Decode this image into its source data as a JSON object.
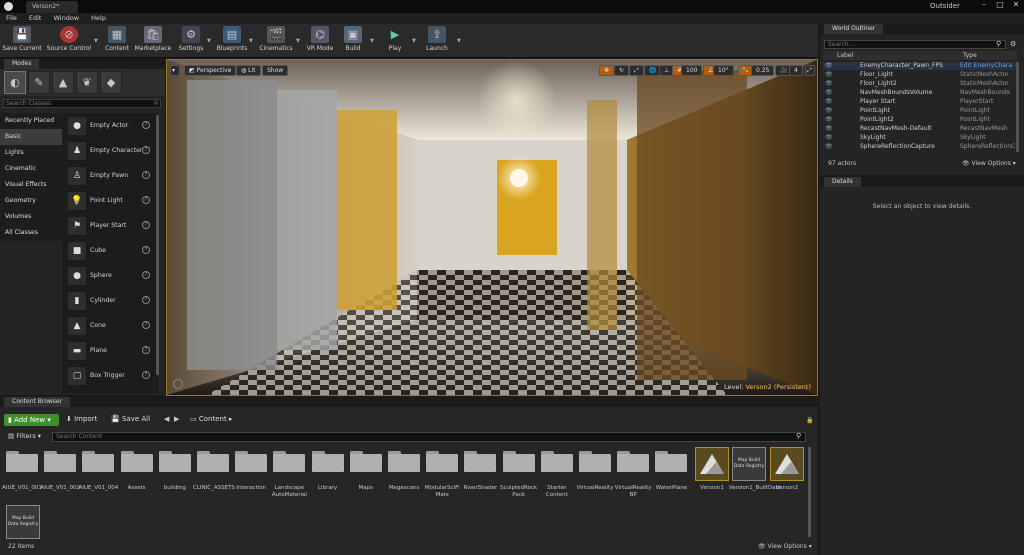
{
  "window": {
    "title": "Verson2*",
    "right_title": "Outsider"
  },
  "menu": [
    "File",
    "Edit",
    "Window",
    "Help"
  ],
  "toolbar": [
    {
      "label": "Save Current",
      "icon": "save-icon"
    },
    {
      "label": "Source Control",
      "icon": "source-control-icon"
    },
    {
      "label": "Content",
      "icon": "content-icon"
    },
    {
      "label": "Marketplace",
      "icon": "marketplace-icon"
    },
    {
      "label": "Settings",
      "icon": "settings-icon"
    },
    {
      "label": "Blueprints",
      "icon": "blueprints-icon"
    },
    {
      "label": "Cinematics",
      "icon": "cinematics-icon"
    },
    {
      "label": "VR Mode",
      "icon": "vr-mode-icon"
    },
    {
      "label": "Build",
      "icon": "build-icon"
    },
    {
      "label": "Play",
      "icon": "play-icon"
    },
    {
      "label": "Launch",
      "icon": "launch-icon"
    }
  ],
  "modes": {
    "tab": "Modes",
    "search_placeholder": "Search Classes",
    "categories": [
      "Recently Placed",
      "Basic",
      "Lights",
      "Cinematic",
      "Visual Effects",
      "Geometry",
      "Volumes",
      "All Classes"
    ],
    "selected_category": "Basic",
    "items": [
      "Empty Actor",
      "Empty Character",
      "Empty Pawn",
      "Point Light",
      "Player Start",
      "Cube",
      "Sphere",
      "Cylinder",
      "Cone",
      "Plane",
      "Box Trigger"
    ]
  },
  "viewport": {
    "perspective": "Perspective",
    "lit": "Lit",
    "show": "Show",
    "grid_snap": "100",
    "rot_snap": "10°",
    "scale_snap": "0.25",
    "cam_speed": "4",
    "level_label": "Level:",
    "level_name": "Verson2 (Persistent)"
  },
  "outliner": {
    "tab": "World Outliner",
    "search_placeholder": "Search...",
    "col_label": "Label",
    "col_type": "Type",
    "rows": [
      {
        "name": "EnemyCharacter_Pawn_FPS",
        "type": "Edit EnemyChara"
      },
      {
        "name": "Floor_Light",
        "type": "StaticMeshActor"
      },
      {
        "name": "Floor_Light2",
        "type": "StaticMeshActor"
      },
      {
        "name": "NavMeshBoundsVolume",
        "type": "NavMeshBounds"
      },
      {
        "name": "Player Start",
        "type": "PlayerStart"
      },
      {
        "name": "PointLight",
        "type": "PointLight"
      },
      {
        "name": "PointLight2",
        "type": "PointLight"
      },
      {
        "name": "RecastNavMesh-Default",
        "type": "RecastNavMesh"
      },
      {
        "name": "SkyLight",
        "type": "SkyLight"
      },
      {
        "name": "SphereReflectionCapture",
        "type": "SphereReflectionC"
      }
    ],
    "count": "97 actors",
    "view_options": "View Options"
  },
  "details": {
    "tab": "Details",
    "empty": "Select an object to view details."
  },
  "content_browser": {
    "tab": "Content Browser",
    "add_new": "Add New",
    "import": "Import",
    "save_all": "Save All",
    "path": "Content",
    "filters": "Filters",
    "search_placeholder": "Search Content",
    "folders": [
      "AIUE_V01_001",
      "AIUE_V01_002",
      "AIUE_V01_004",
      "Assets",
      "building",
      "CLINIC_ASSETS",
      "Interaction",
      "Landscape AutoMaterial",
      "Library",
      "Maps",
      "Megascans",
      "ModularSciFi Mats",
      "RiverShader",
      "SculptedRock Pack",
      "Starter Content",
      "VirtualReality",
      "VirtualReality BP",
      "WaterPlane"
    ],
    "assets": [
      {
        "label": "Version1",
        "thumb": ""
      },
      {
        "label": "Version1_BuiltData",
        "thumb": "Map Build Data Registry"
      },
      {
        "label": "Verson2",
        "thumb": ""
      },
      {
        "label": "",
        "thumb": "Map Build Data Registry"
      }
    ],
    "count": "22 items",
    "view_options": "View Options"
  }
}
